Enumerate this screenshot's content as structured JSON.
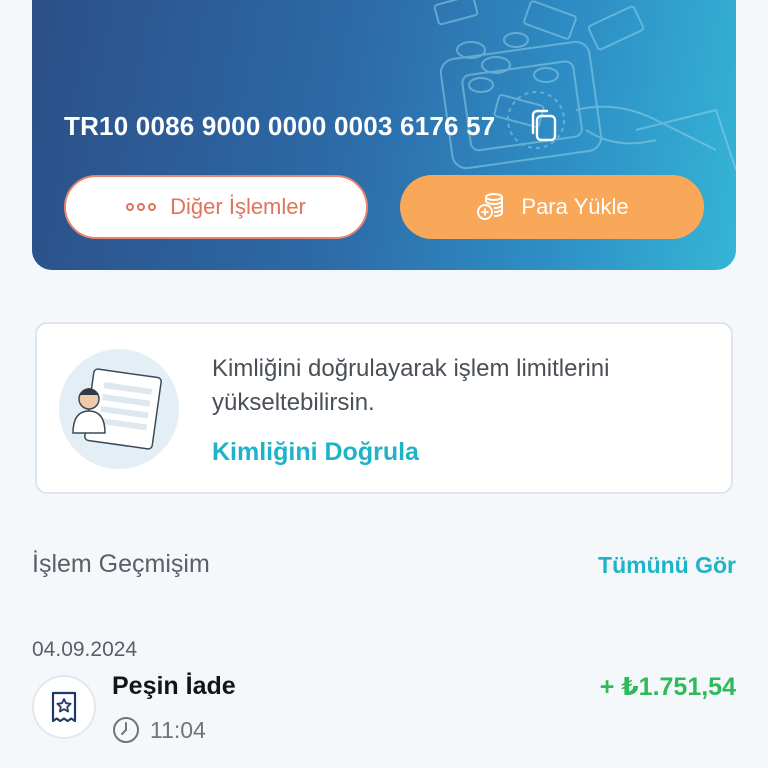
{
  "account": {
    "iban": "TR10 0086 9000 0000 0003 6176 57",
    "copy_icon": "copy-icon"
  },
  "actions": {
    "other_label": "Diğer İşlemler",
    "load_label": "Para Yükle"
  },
  "verify": {
    "message": "Kimliğini doğrulayarak işlem limitlerini yükseltebilirsin.",
    "link_label": "Kimliğini Doğrula"
  },
  "history": {
    "title": "İşlem Geçmişim",
    "see_all_label": "Tümünü Gör",
    "transactions": [
      {
        "date": "04.09.2024",
        "name": "Peşin İade",
        "time": "11:04",
        "amount": "+ ₺1.751,54",
        "icon": "receipt-star-icon"
      }
    ]
  },
  "colors": {
    "card_gradient_start": "#2b4f86",
    "card_gradient_end": "#35b5d6",
    "accent_teal": "#1fb3c8",
    "accent_orange": "#f9a85a",
    "danger_outline": "#e8836f",
    "positive_amount": "#2fba59"
  }
}
